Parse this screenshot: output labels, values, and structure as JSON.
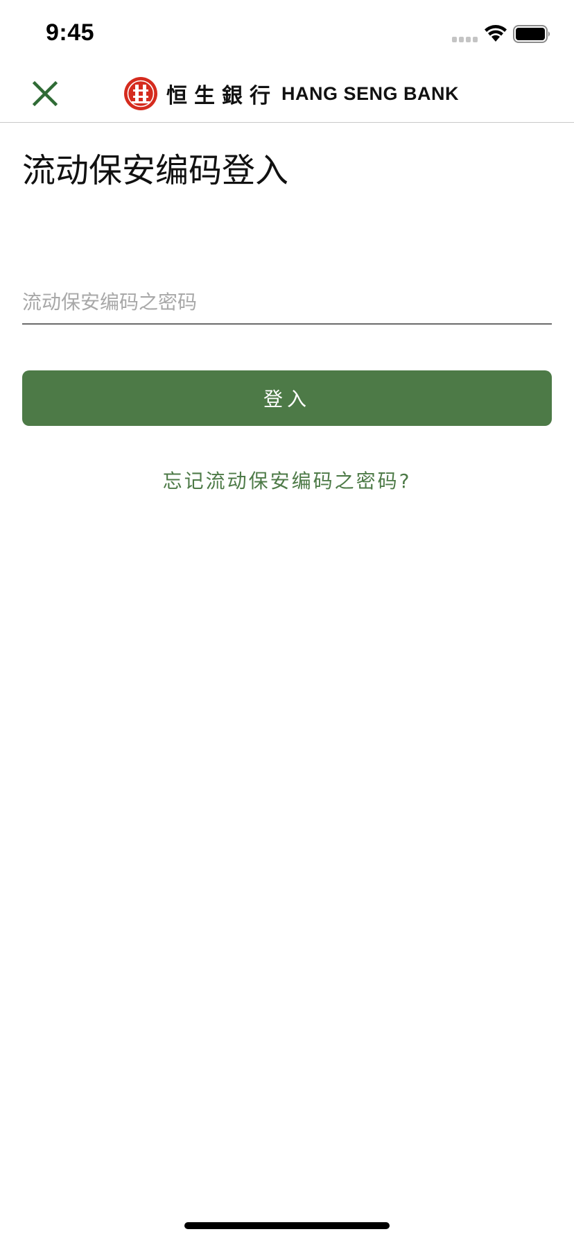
{
  "status_bar": {
    "time": "9:45",
    "icons": [
      "cellular-signal-icon",
      "wifi-icon",
      "battery-icon"
    ]
  },
  "nav_bar": {
    "close_icon": "close-icon",
    "logo": {
      "emblem": "hang-seng-emblem-icon",
      "name_cn": "恒生銀行",
      "name_en": "HANG SENG BANK"
    }
  },
  "main": {
    "title": "流动保安编码登入",
    "password_field": {
      "placeholder": "流动保安编码之密码",
      "value": ""
    },
    "login_button_label": "登入",
    "forgot_link_label": "忘记流动保安编码之密码?"
  },
  "colors": {
    "brand_green": "#4d7a47",
    "close_icon_green": "#2f6b35",
    "logo_red": "#d52b1e",
    "placeholder_gray": "#a8a8a8",
    "divider_gray": "#c8c8c8"
  }
}
